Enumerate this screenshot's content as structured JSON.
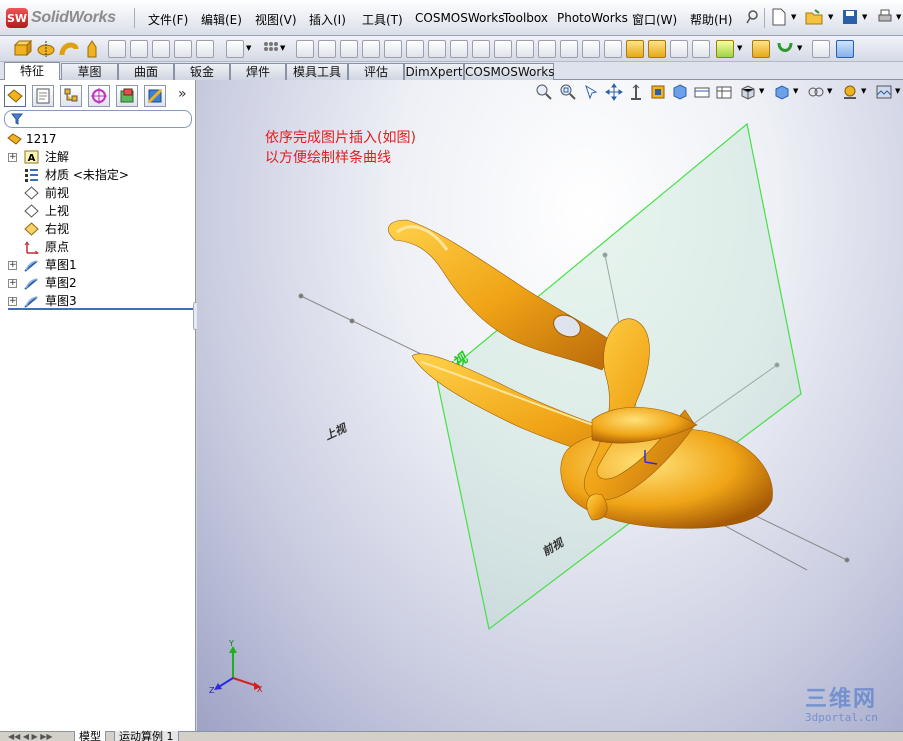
{
  "app": {
    "brand": "SolidWorks",
    "brand_badge": "SW"
  },
  "menu": {
    "items": [
      "文件(F)",
      "编辑(E)",
      "视图(V)",
      "插入(I)",
      "工具(T)",
      "COSMOSWorks",
      "Toolbox",
      "PhotoWorks",
      "窗口(W)",
      "帮助(H)"
    ]
  },
  "tabs": {
    "items": [
      "特征",
      "草图",
      "曲面",
      "钣金",
      "焊件",
      "模具工具",
      "评估",
      "DimXpert",
      "COSMOSWorks"
    ],
    "active_index": 0
  },
  "feature_tree": {
    "root": "1217",
    "items": [
      {
        "label": "注解",
        "expandable": true,
        "icon": "annotation-icon"
      },
      {
        "label": "材质 <未指定>",
        "expandable": false,
        "icon": "material-icon"
      },
      {
        "label": "前视",
        "expandable": false,
        "icon": "plane-icon"
      },
      {
        "label": "上视",
        "expandable": false,
        "icon": "plane-icon"
      },
      {
        "label": "右视",
        "expandable": false,
        "icon": "plane-icon"
      },
      {
        "label": "原点",
        "expandable": false,
        "icon": "origin-icon"
      },
      {
        "label": "草图1",
        "expandable": true,
        "icon": "sketch-icon"
      },
      {
        "label": "草图2",
        "expandable": true,
        "icon": "sketch-icon"
      },
      {
        "label": "草图3",
        "expandable": true,
        "icon": "sketch-icon"
      }
    ]
  },
  "viewport": {
    "note_line1": "依序完成图片插入(如图)",
    "note_line2": "以方便绘制样条曲线",
    "plane_right": "右视",
    "plane_top": "上视",
    "plane_front": "前视",
    "triad_x": "X",
    "triad_y": "Y",
    "triad_z": "Z"
  },
  "bottom_tabs": {
    "items": [
      "模型",
      "运动算例 1"
    ],
    "active_index": 0
  },
  "watermark": {
    "line1": "三维网",
    "line2": "3dportal.cn"
  },
  "colors": {
    "accent_blue": "#3f6fb5",
    "note_red": "#e11d1d",
    "plane_green": "#46e046",
    "model_gold": "#f0a416"
  }
}
